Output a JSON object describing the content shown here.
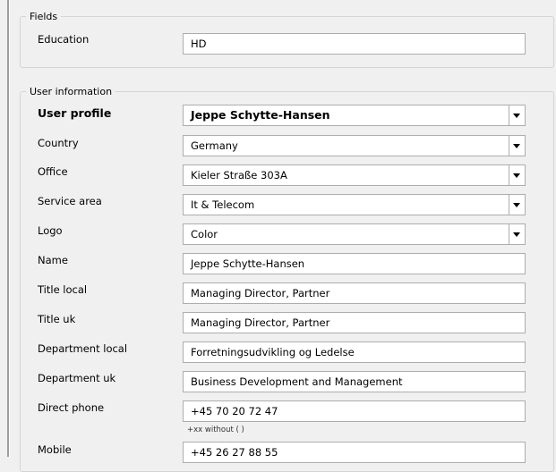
{
  "groups": {
    "fields_title": "Fields",
    "user_info_title": "User information"
  },
  "fields": {
    "education_label": "Education",
    "education_value": "HD"
  },
  "user_info": {
    "user_profile_label": "User profile",
    "user_profile_value": "Jeppe Schytte-Hansen",
    "country_label": "Country",
    "country_value": "Germany",
    "office_label": "Office",
    "office_value": "Kieler Straße 303A",
    "service_area_label": "Service area",
    "service_area_value": "It & Telecom",
    "logo_label": "Logo",
    "logo_value": "Color",
    "name_label": "Name",
    "name_value": "Jeppe Schytte-Hansen",
    "title_local_label": "Title local",
    "title_local_value": "Managing Director, Partner",
    "title_uk_label": "Title uk",
    "title_uk_value": "Managing Director, Partner",
    "department_local_label": "Department local",
    "department_local_value": "Forretningsudvikling og Ledelse",
    "department_uk_label": "Department uk",
    "department_uk_value": "Business Development and Management",
    "direct_phone_label": "Direct phone",
    "direct_phone_value": "+45 70 20 72 47",
    "direct_phone_hint": "+xx without ( )",
    "mobile_label": "Mobile",
    "mobile_value": "+45 26 27 88 55"
  }
}
